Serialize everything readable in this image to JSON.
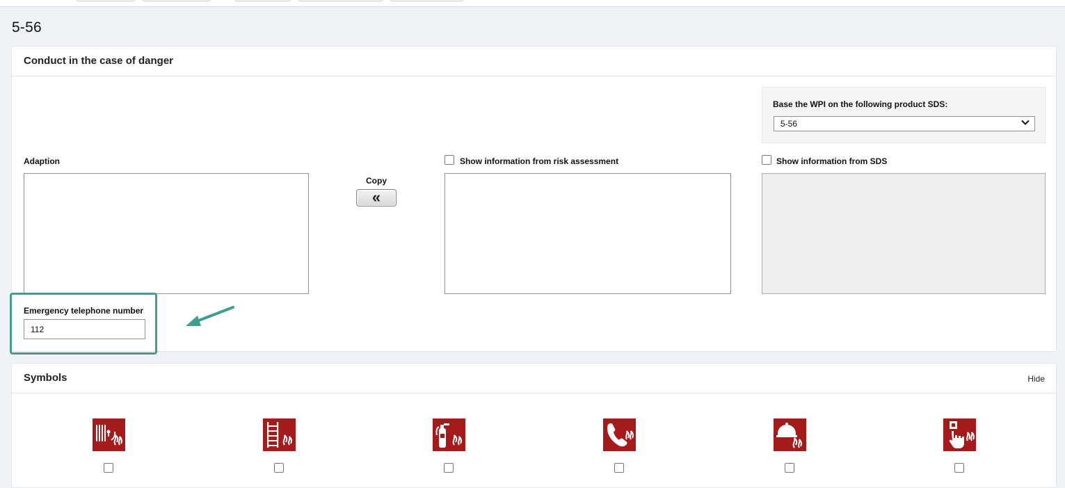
{
  "page": {
    "title": "5-56"
  },
  "danger_card": {
    "title": "Conduct in the case of danger",
    "sds_label": "Base the WPI on the following product SDS:",
    "sds_selected": "5-56",
    "adaption_label": "Adaption",
    "copy_label": "Copy",
    "copy_button_glyph": "«",
    "risk_label": "Show information from risk assessment",
    "sds_info_label": "Show information from SDS",
    "emergency_label": "Emergency telephone number",
    "emergency_value": "112",
    "highlight_color": "#3f9e8c"
  },
  "symbols_card": {
    "title": "Symbols",
    "hide_label": "Hide",
    "symbol_color": "#a51b1b",
    "items": [
      {
        "icon": "fire-hose-icon"
      },
      {
        "icon": "fire-ladder-icon"
      },
      {
        "icon": "fire-extinguisher-icon"
      },
      {
        "icon": "fire-emergency-phone-icon"
      },
      {
        "icon": "fire-alarm-bell-icon"
      },
      {
        "icon": "fire-alarm-call-point-icon"
      }
    ]
  }
}
